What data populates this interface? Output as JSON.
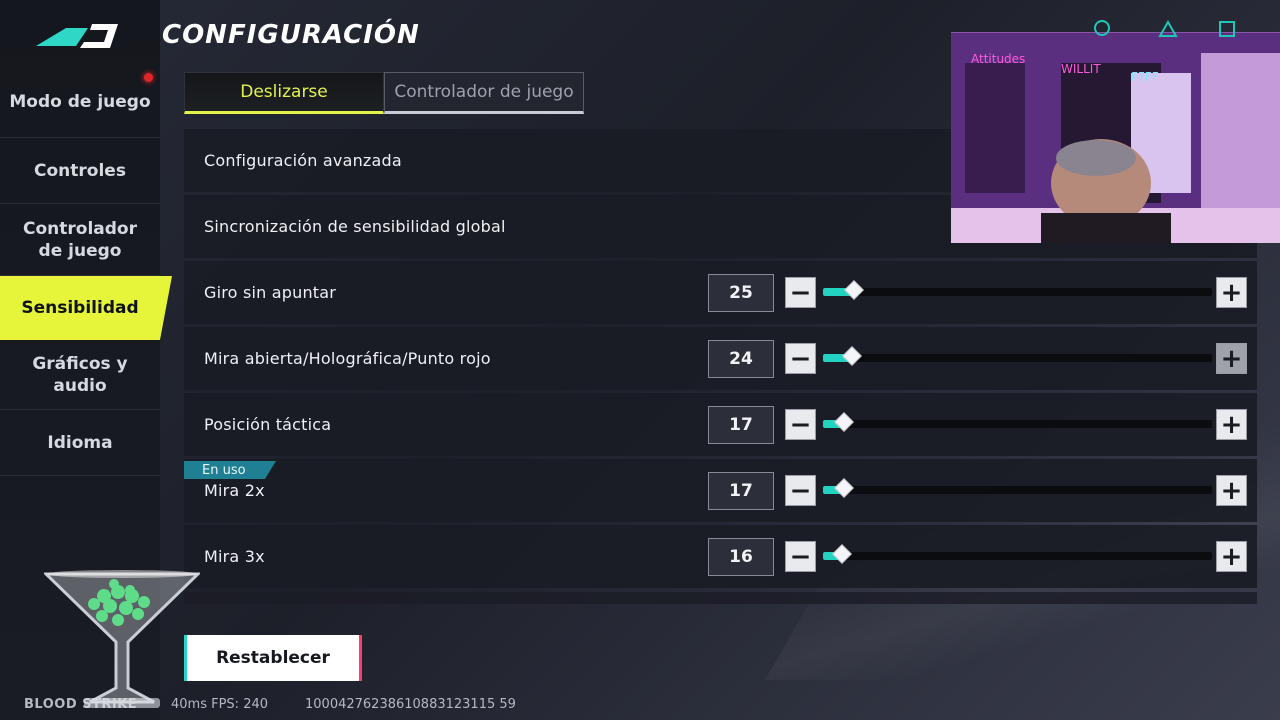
{
  "header": {
    "title": "CONFIGURACIÓN"
  },
  "sidebar": {
    "items": [
      {
        "label": "Modo de juego",
        "active": false
      },
      {
        "label": "Controles",
        "active": false
      },
      {
        "label": "Controlador de juego",
        "active": false
      },
      {
        "label": "Sensibilidad",
        "active": true
      },
      {
        "label": "Gráficos y audio",
        "active": false
      },
      {
        "label": "Idioma",
        "active": false
      }
    ]
  },
  "tabs": [
    {
      "label": "Deslizarse",
      "active": true
    },
    {
      "label": "Controlador de juego",
      "active": false
    }
  ],
  "settings": {
    "advanced": "Configuración avanzada",
    "global_sync": "Sincronización de sensibilidad global",
    "sliders": [
      {
        "label": "Giro sin apuntar",
        "value": "25",
        "min": 0,
        "max": 200,
        "fill": 0.08
      },
      {
        "label": "Mira abierta/Holográfica/Punto rojo",
        "value": "24",
        "min": 0,
        "max": 200,
        "fill": 0.075
      },
      {
        "label": "Posición táctica",
        "value": "17",
        "min": 0,
        "max": 200,
        "fill": 0.053
      },
      {
        "label": "Mira 2x",
        "value": "17",
        "min": 0,
        "max": 200,
        "fill": 0.053,
        "badge": "En uso"
      },
      {
        "label": "Mira 3x",
        "value": "16",
        "min": 0,
        "max": 200,
        "fill": 0.05
      }
    ]
  },
  "reset_label": "Restablecer",
  "footer": {
    "brand": "BLOOD STRIKE",
    "fps": "40ms FPS: 240",
    "id": "10004276238610883123115 59"
  },
  "colors": {
    "accent_yellow": "#e6f53a",
    "slider_teal": "#22d3c2",
    "badge_teal": "#1f7f93"
  },
  "icons": [
    "logo-icon",
    "minus-icon",
    "plus-icon",
    "cocktail-glass-icon"
  ]
}
